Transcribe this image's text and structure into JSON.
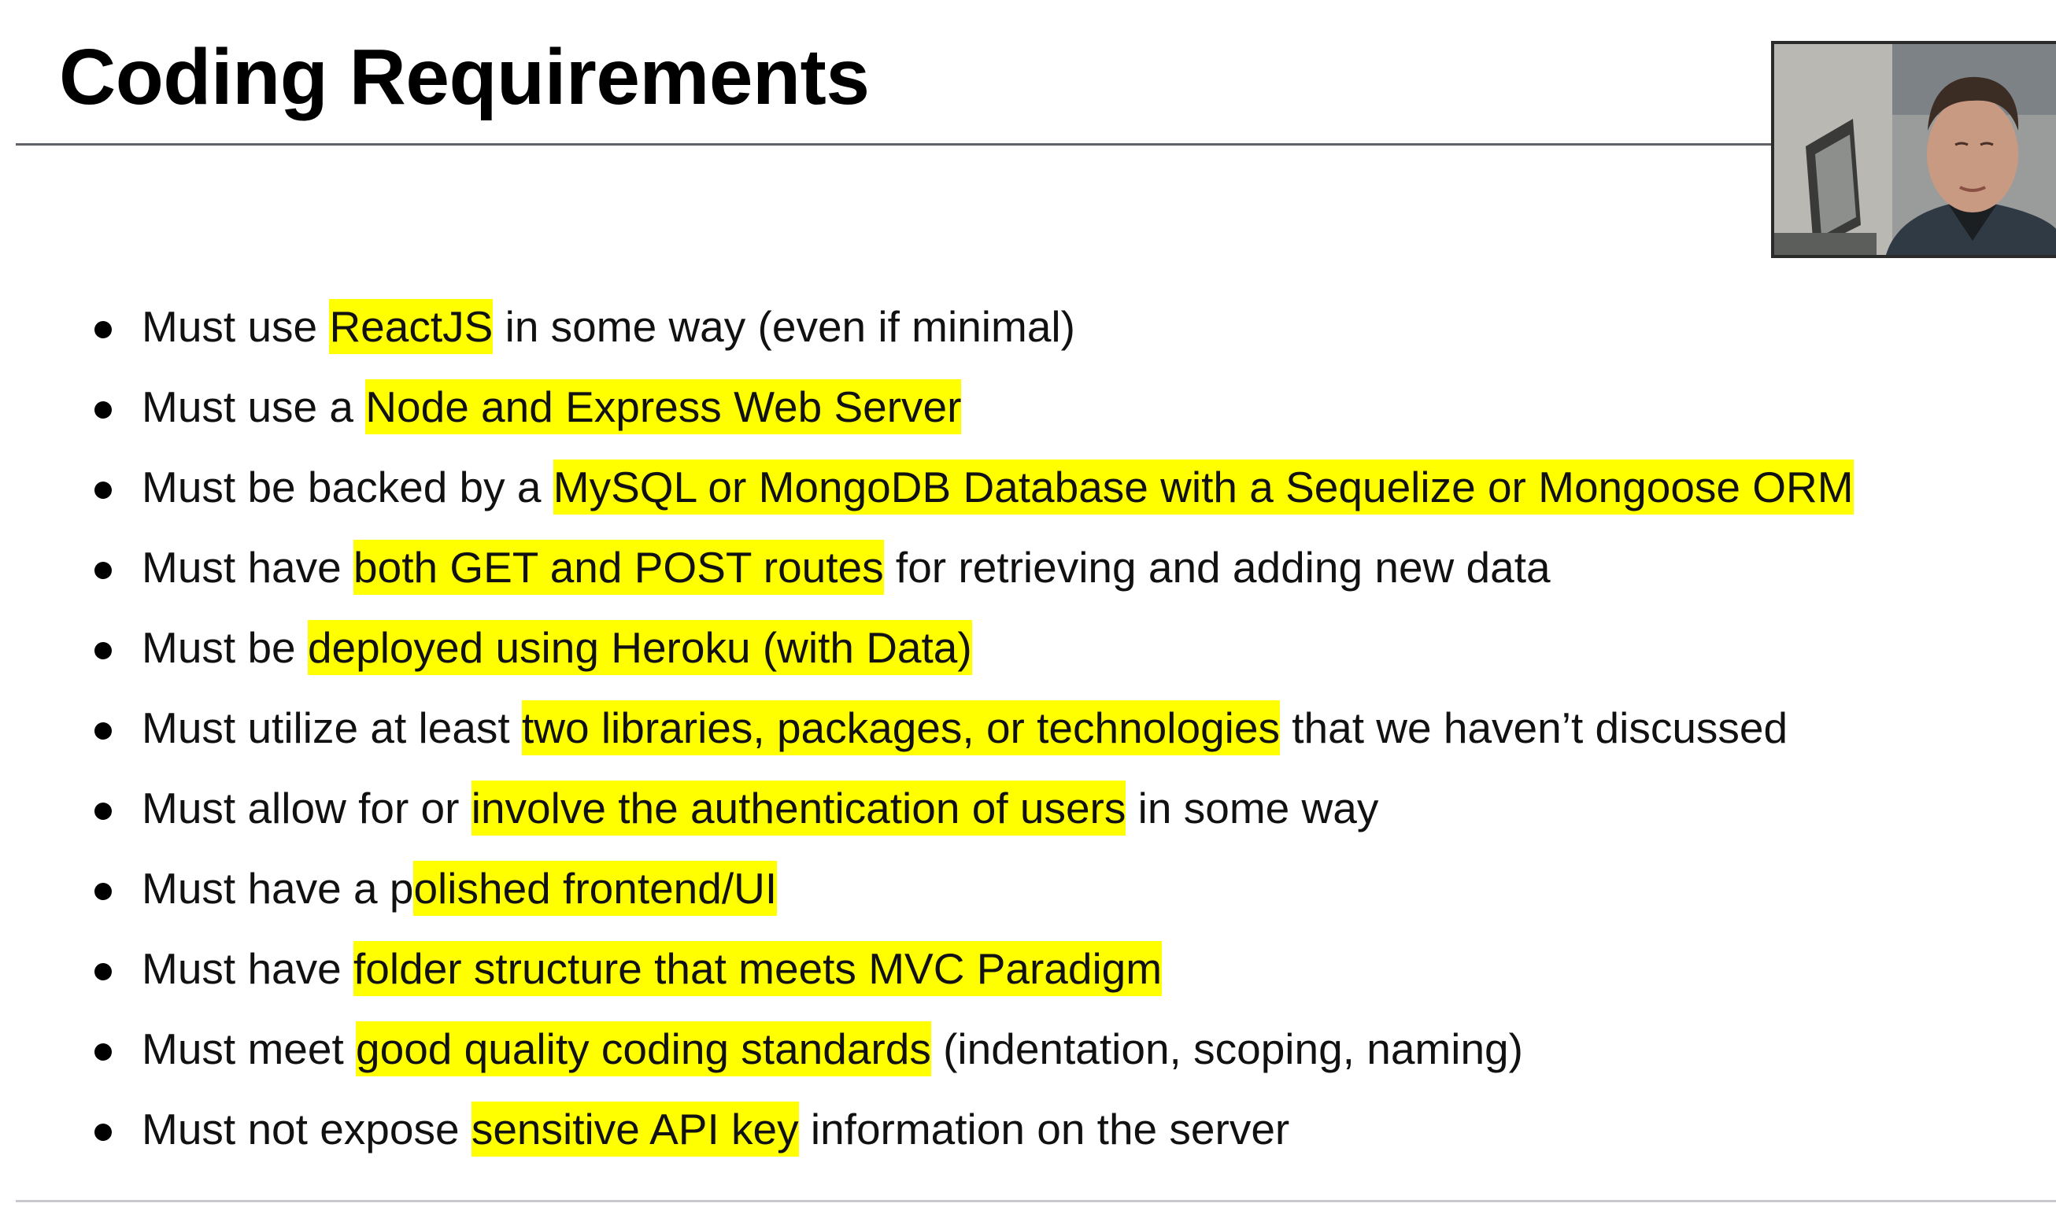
{
  "slide": {
    "title": "Coding Requirements"
  },
  "webcam": {
    "description": "presenter-webcam"
  },
  "requirements": [
    {
      "pre": "Must use ",
      "hl": "ReactJS",
      "post": " in some way (even if minimal)"
    },
    {
      "pre": "Must use a ",
      "hl": "Node and Express Web Server",
      "post": ""
    },
    {
      "pre": "Must be backed by a ",
      "hl": "MySQL or MongoDB Database with a Sequelize or Mongoose ORM",
      "post": ""
    },
    {
      "pre": "Must have ",
      "hl": "both GET and POST routes",
      "post": " for retrieving and adding new data"
    },
    {
      "pre": "Must be ",
      "hl": "deployed using Heroku (with Data)",
      "post": ""
    },
    {
      "pre": "Must utilize at least ",
      "hl": "two libraries, packages, or technologies",
      "post": " that we haven’t discussed"
    },
    {
      "pre": "Must allow for or ",
      "hl": "involve the authentication of users",
      "post": " in some way"
    },
    {
      "pre": "Must have a p",
      "hl": "olished frontend/UI",
      "post": ""
    },
    {
      "pre": "Must have ",
      "hl": "folder structure that meets MVC Paradigm",
      "post": ""
    },
    {
      "pre": "Must meet ",
      "hl": "good quality coding standards",
      "post": " (indentation, scoping, naming)"
    },
    {
      "pre": "Must not expose ",
      "hl": "sensitive API key",
      "post": " information on the server"
    }
  ],
  "colors": {
    "highlight": "#ffff00",
    "title_rule": "#5f6368"
  }
}
